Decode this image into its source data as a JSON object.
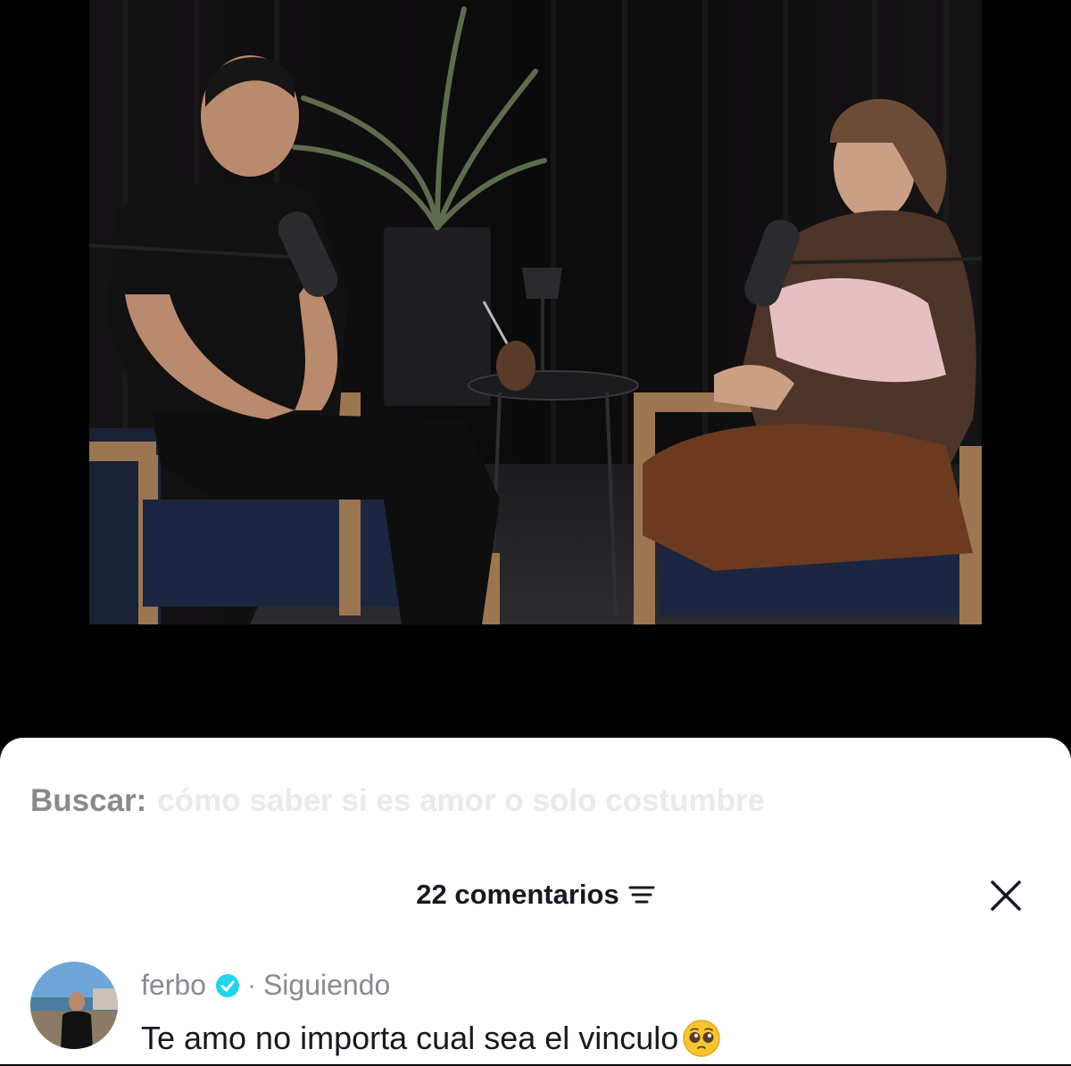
{
  "search": {
    "label": "Buscar:",
    "query": "cómo saber si es amor o solo costumbre"
  },
  "comments_panel": {
    "count_label": "22 comentarios",
    "icons": {
      "filter": "filter-lines-icon",
      "close": "close-x-icon"
    }
  },
  "comment": {
    "username": "ferbo",
    "separator": "·",
    "follow_status": "Siguiendo",
    "text": "Te amo no importa cual sea el vinculo",
    "icons": {
      "verified": "verified-check-icon",
      "emoji": "pleading-face-emoji"
    }
  },
  "colors": {
    "verified": "#20d5ec",
    "text_primary": "#161823",
    "text_secondary": "#8a8b91"
  }
}
